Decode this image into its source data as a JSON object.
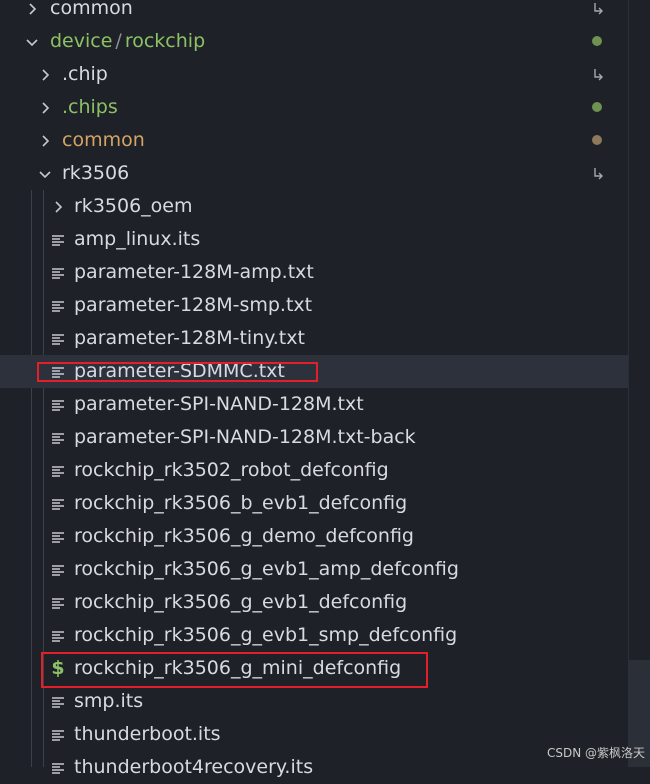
{
  "explorer": {
    "items": [
      {
        "label": "common",
        "kind": "folder",
        "expanded": false,
        "color": "#d7dae0",
        "badge": "arrow"
      },
      {
        "label": "device",
        "sub": "rockchip",
        "kind": "folder",
        "expanded": true,
        "color": "#8cc265",
        "badge": "dot-green"
      },
      {
        "label": ".chip",
        "kind": "folder",
        "expanded": false,
        "color": "#d7dae0",
        "badge": "arrow"
      },
      {
        "label": ".chips",
        "kind": "folder",
        "expanded": false,
        "color": "#8cc265",
        "badge": "dot-green"
      },
      {
        "label": "common",
        "kind": "folder",
        "expanded": false,
        "color": "#d3a463",
        "badge": "dot-yellow"
      },
      {
        "label": "rk3506",
        "kind": "folder",
        "expanded": true,
        "color": "#d7dae0",
        "badge": "arrow"
      },
      {
        "label": "rk3506_oem",
        "kind": "folder",
        "expanded": false,
        "color": "#d7dae0"
      },
      {
        "label": "amp_linux.its",
        "kind": "file"
      },
      {
        "label": "parameter-128M-amp.txt",
        "kind": "file"
      },
      {
        "label": "parameter-128M-smp.txt",
        "kind": "file"
      },
      {
        "label": "parameter-128M-tiny.txt",
        "kind": "file"
      },
      {
        "label": "parameter-SDMMC.txt",
        "kind": "file",
        "selected": true
      },
      {
        "label": "parameter-SPI-NAND-128M.txt",
        "kind": "file"
      },
      {
        "label": "parameter-SPI-NAND-128M.txt-back",
        "kind": "file"
      },
      {
        "label": "rockchip_rk3502_robot_defconfig",
        "kind": "file"
      },
      {
        "label": "rockchip_rk3506_b_evb1_defconfig",
        "kind": "file"
      },
      {
        "label": "rockchip_rk3506_g_demo_defconfig",
        "kind": "file"
      },
      {
        "label": "rockchip_rk3506_g_evb1_amp_defconfig",
        "kind": "file"
      },
      {
        "label": "rockchip_rk3506_g_evb1_defconfig",
        "kind": "file"
      },
      {
        "label": "rockchip_rk3506_g_evb1_smp_defconfig",
        "kind": "file"
      },
      {
        "label": "rockchip_rk3506_g_mini_defconfig",
        "kind": "shell",
        "icon": "$"
      },
      {
        "label": "smp.its",
        "kind": "file"
      },
      {
        "label": "thunderboot.its",
        "kind": "file"
      },
      {
        "label": "thunderboot4recovery.its",
        "kind": "file"
      }
    ],
    "separator": "/"
  },
  "watermark": "CSDN @紫枫洛天",
  "colors": {
    "background": "#1e2127",
    "selected_row": "#2c313c",
    "green": "#8cc265",
    "yellow_dot": "#8c7a5a",
    "highlight_box": "#e3202a"
  }
}
